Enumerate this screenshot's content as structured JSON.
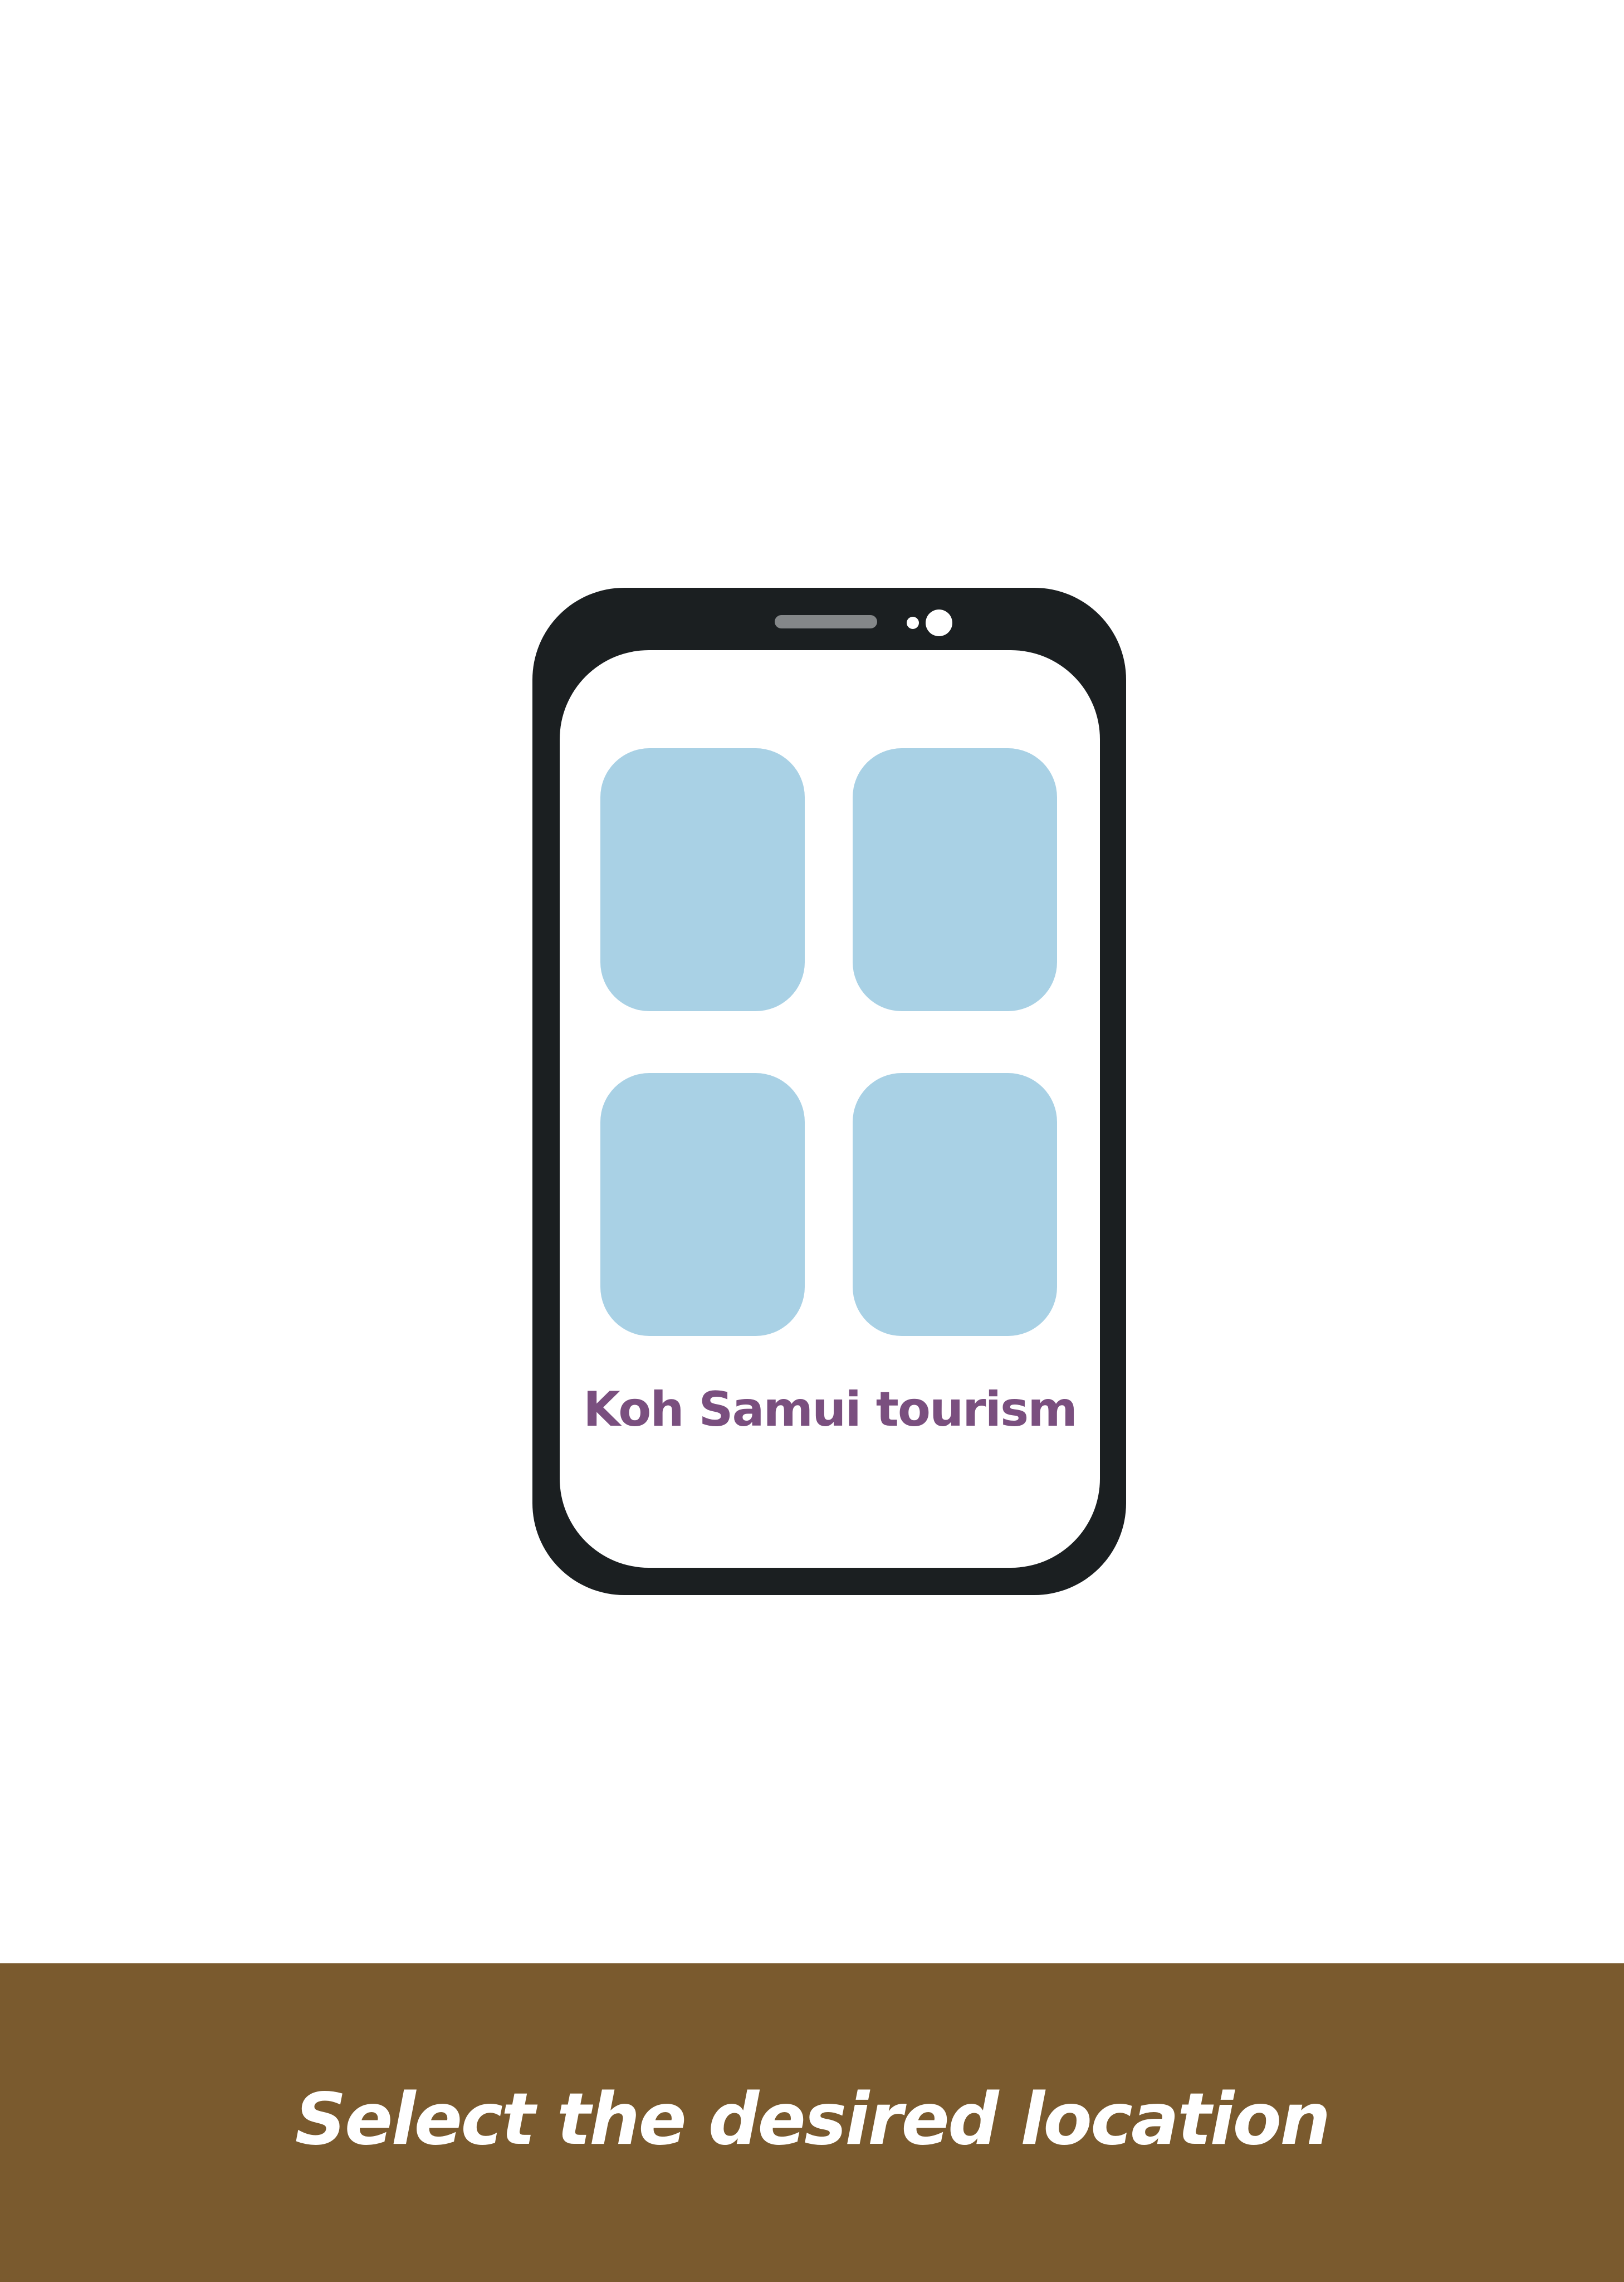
{
  "screen": {
    "app_title": "Koh Samui tourism",
    "tiles": [
      {
        "label": ""
      },
      {
        "label": ""
      },
      {
        "label": ""
      },
      {
        "label": ""
      }
    ]
  },
  "footer": {
    "instruction": "Select the desired location"
  },
  "colors": {
    "phone_body": "#1b1f21",
    "speaker": "#848789",
    "tile": "#a9d1e5",
    "app_title": "#7a4f7f",
    "footer_background": "#7a5a2e",
    "footer_text": "#ffffff"
  }
}
